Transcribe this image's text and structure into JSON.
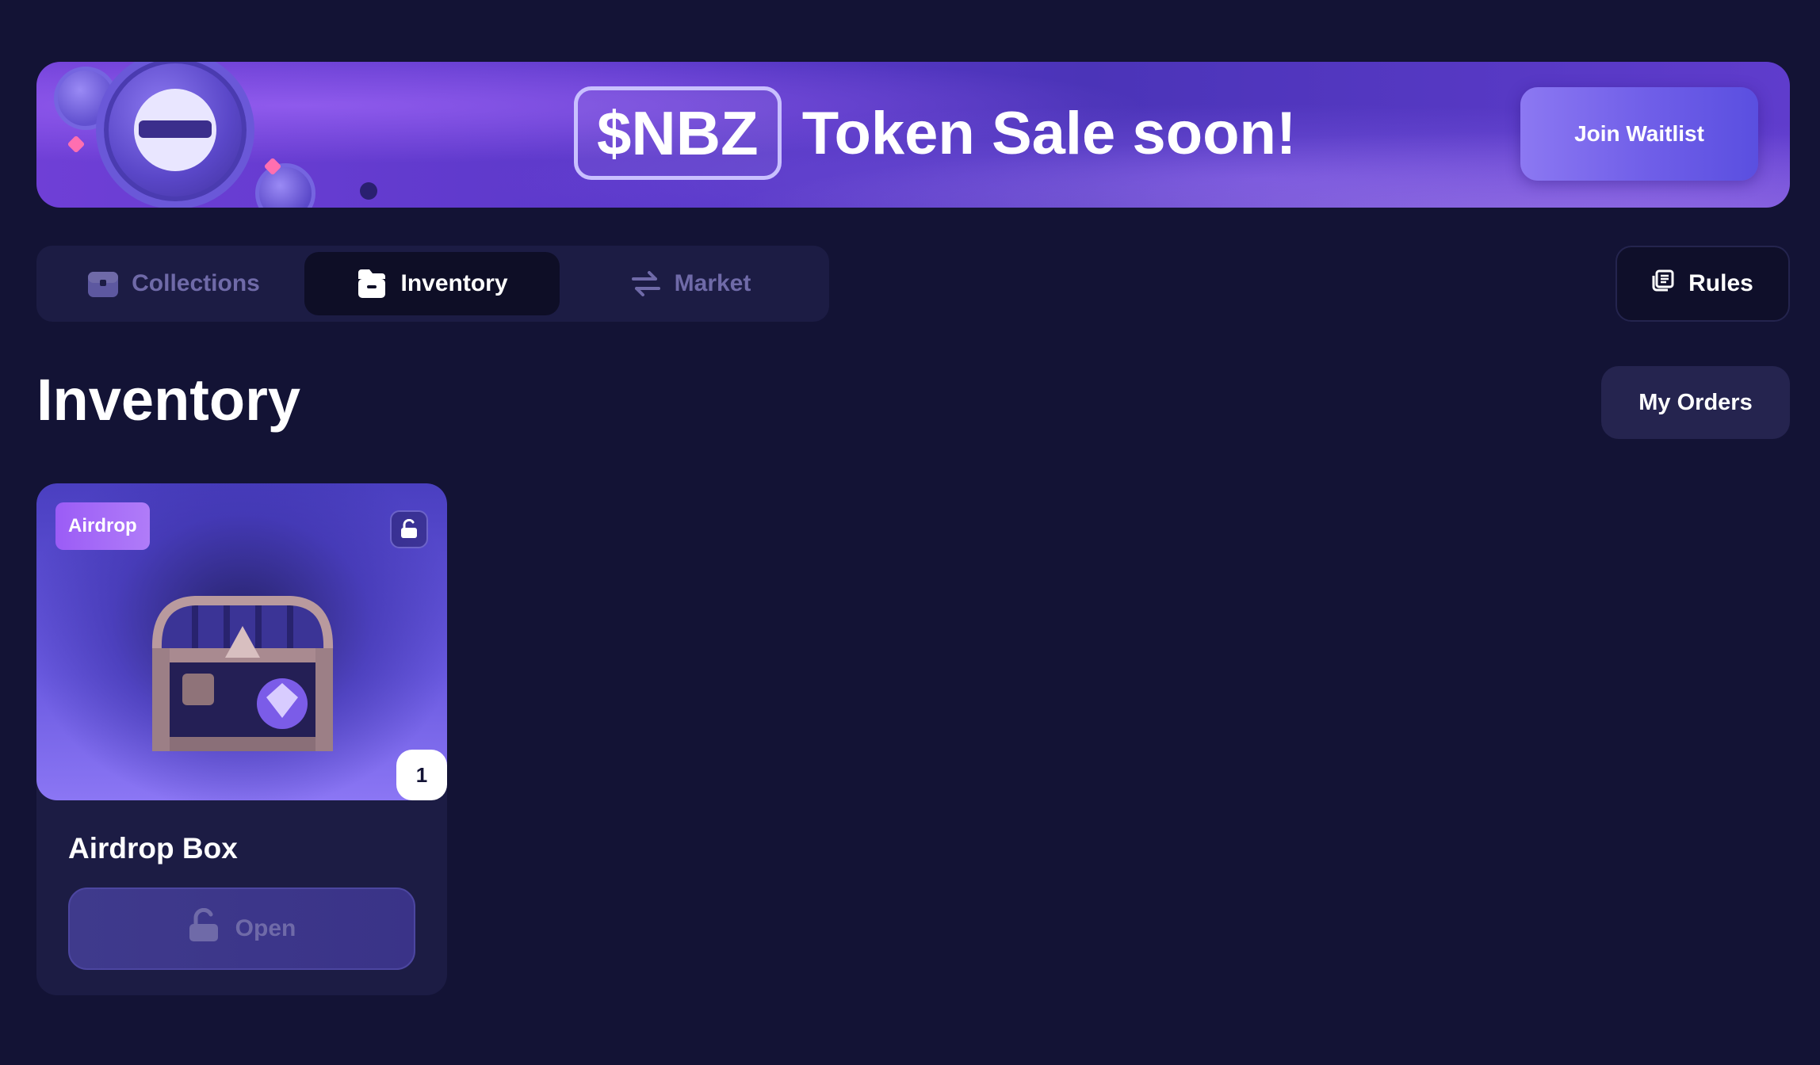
{
  "banner": {
    "token": "$NBZ",
    "headline": "Token Sale soon!",
    "join_label": "Join Waitlist"
  },
  "tabs": [
    {
      "label": "Collections",
      "icon": "chest-icon",
      "active": false
    },
    {
      "label": "Inventory",
      "icon": "folder-icon",
      "active": true
    },
    {
      "label": "Market",
      "icon": "swap-arrows-icon",
      "active": false
    }
  ],
  "rules_label": "Rules",
  "page_title": "Inventory",
  "my_orders_label": "My Orders",
  "items": [
    {
      "badge": "Airdrop",
      "count": "1",
      "name": "Airdrop Box",
      "action_label": "Open"
    }
  ],
  "colors": {
    "background": "#131335",
    "panel": "#1c1c44",
    "accent": "#8c78f2",
    "badge": "#9b5cf6",
    "muted_text": "#6f6aa8"
  }
}
